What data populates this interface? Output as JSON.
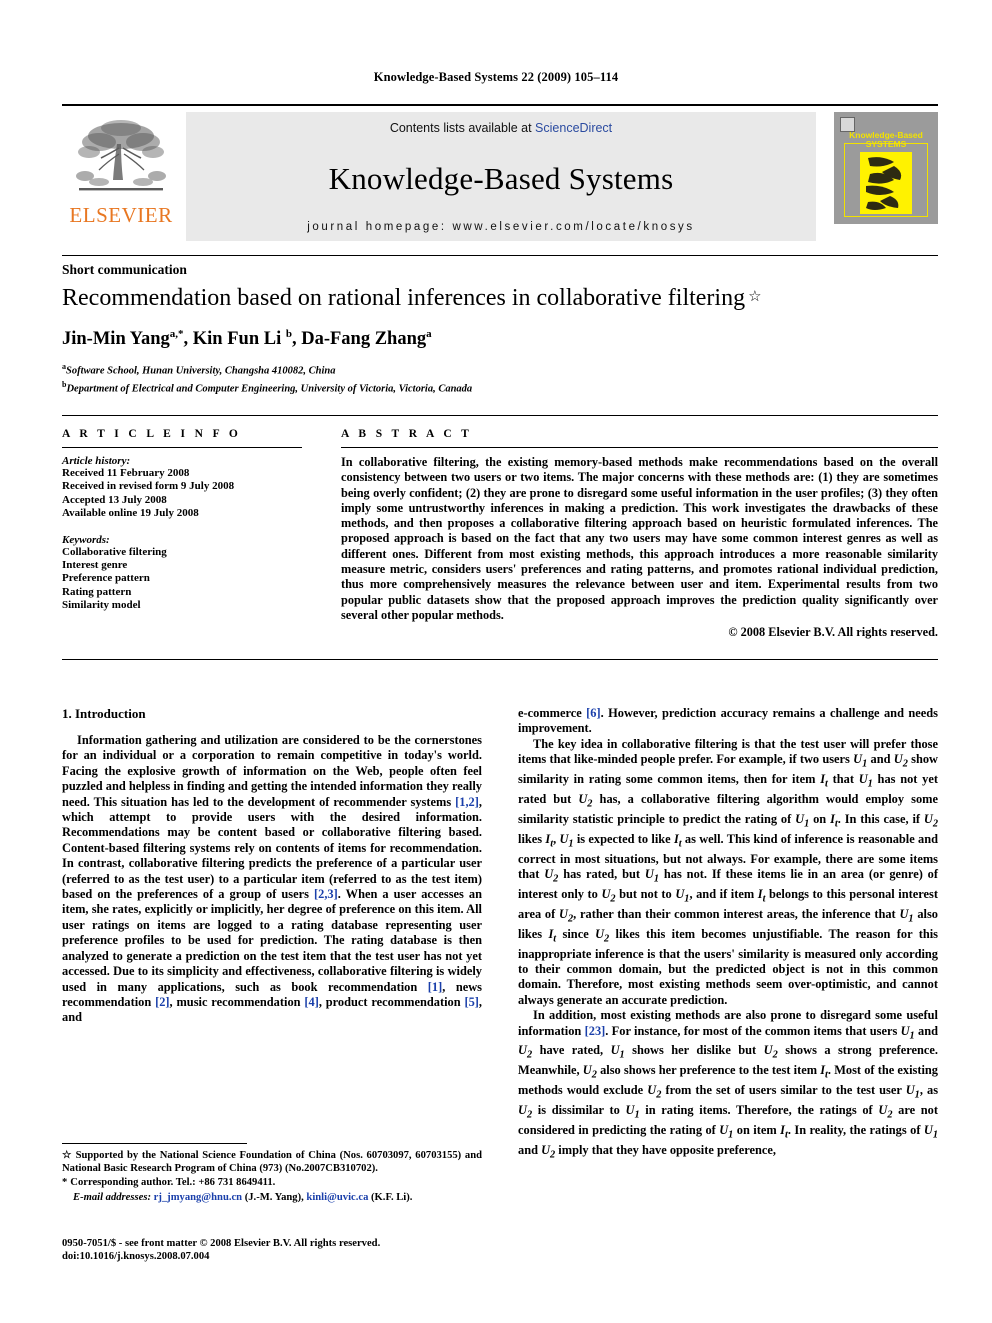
{
  "running_head": "Knowledge-Based Systems 22 (2009) 105–114",
  "masthead": {
    "publisher_word": "ELSEVIER",
    "contents_prefix": "Contents lists available at ",
    "sciencedirect": "ScienceDirect",
    "journal_name": "Knowledge-Based Systems",
    "homepage": "journal homepage: www.elsevier.com/locate/knosys",
    "cover_title_line1": "Knowledge-Based",
    "cover_title_line2": "SYSTEMS"
  },
  "article": {
    "type": "Short communication",
    "title": "Recommendation based on rational inferences in collaborative filtering",
    "title_footnote_mark": "☆",
    "authors": "Jin-Min Yang",
    "author_marks_1": "a,*",
    "author_2": ", Kin Fun Li ",
    "author_marks_2": "b",
    "author_3": ", Da-Fang Zhang",
    "author_marks_3": "a",
    "affiliation_a_mark": "a",
    "affiliation_a": "Software School, Hunan University, Changsha 410082, China",
    "affiliation_b_mark": "b",
    "affiliation_b": "Department of Electrical and Computer Engineering, University of Victoria, Victoria, Canada"
  },
  "info": {
    "heading": "A R T I C L E    I N F O",
    "history_label": "Article history:",
    "history": [
      "Received 11 February 2008",
      "Received in revised form 9 July 2008",
      "Accepted 13 July 2008",
      "Available online 19 July 2008"
    ],
    "keywords_label": "Keywords:",
    "keywords": [
      "Collaborative filtering",
      "Interest genre",
      "Preference pattern",
      "Rating pattern",
      "Similarity model"
    ]
  },
  "abstract": {
    "heading": "A B S T R A C T",
    "text": "In collaborative filtering, the existing memory-based methods make recommendations based on the overall consistency between two users or two items. The major concerns with these methods are: (1) they are sometimes being overly confident; (2) they are prone to disregard some useful information in the user profiles; (3) they often imply some untrustworthy inferences in making a prediction. This work investigates the drawbacks of these methods, and then proposes a collaborative filtering approach based on heuristic formulated inferences. The proposed approach is based on the fact that any two users may have some common interest genres as well as different ones. Different from most existing methods, this approach introduces a more reasonable similarity measure metric, considers users' preferences and rating patterns, and promotes rational individual prediction, thus more comprehensively measures the relevance between user and item. Experimental results from two popular public datasets show that the proposed approach improves the prediction quality significantly over several other popular methods.",
    "copyright": "© 2008 Elsevier B.V. All rights reserved."
  },
  "body": {
    "section_title": "1. Introduction",
    "left_p1_a": "Information gathering and utilization are considered to be the cornerstones for an individual or a corporation to remain competitive in today's world. Facing the explosive growth of information on the Web, people often feel puzzled and helpless in finding and getting the intended information they really need. This situation has led to the development of recommender systems ",
    "left_p1_ref1": "[1,2]",
    "left_p1_b": ", which attempt to provide users with the desired information. Recommendations may be content based or collaborative filtering based. Content-based filtering systems rely on contents of items for recommendation. In contrast, collaborative filtering predicts the preference of a particular user (referred to as the test user) to a particular item (referred to as the test item) based on the preferences of a group of users ",
    "left_p1_ref2": "[2,3]",
    "left_p1_c": ". When a user accesses an item, she rates, explicitly or implicitly, her degree of preference on this item. All user ratings on items are logged to a rating database representing user preference profiles to be used for prediction. The rating database is then analyzed to generate a prediction on the test item that the test user has not yet accessed. Due to its simplicity and effectiveness, collaborative filtering is widely used in many applications, such as book recommendation ",
    "left_p1_ref3": "[1]",
    "left_p1_d": ", news recommendation ",
    "left_p1_ref4": "[2]",
    "left_p1_e": ", music recommendation ",
    "left_p1_ref5": "[4]",
    "left_p1_f": ", product recommendation ",
    "left_p1_ref6": "[5]",
    "left_p1_g": ", and",
    "right_p1_a": "e-commerce ",
    "right_p1_ref": "[6]",
    "right_p1_b": ". However, prediction accuracy remains a challenge and needs improvement.",
    "right_p2": "The key idea in collaborative filtering is that the test user will prefer those items that like-minded people prefer. For example, if two users U1 and U2 show similarity in rating some common items, then for item It that U1 has not yet rated but U2 has, a collaborative filtering algorithm would employ some similarity statistic principle to predict the rating of U1 on It. In this case, if U2 likes It, U1 is expected to like It as well. This kind of inference is reasonable and correct in most situations, but not always. For example, there are some items that U2 has rated, but U1 has not. If these items lie in an area (or genre) of interest only to U2 but not to U1, and if item It belongs to this personal interest area of U2, rather than their common interest areas, the inference that U1 also likes It since U2 likes this item becomes unjustifiable. The reason for this inappropriate inference is that the users' similarity is measured only according to their common domain, but the predicted object is not in this common domain. Therefore, most existing methods seem over-optimistic, and cannot always generate an accurate prediction.",
    "right_p3_a": "In addition, most existing methods are also prone to disregard some useful information ",
    "right_p3_ref": "[23]",
    "right_p3_b": ". For instance, for most of the common items that users U1 and U2 have rated, U1 shows her dislike but U2 shows a strong preference. Meanwhile, U2 also shows her preference to the test item It. Most of the existing methods would exclude U2 from the set of users similar to the test user U1, as U2 is dissimilar to U1 in rating items. Therefore, the ratings of U2 are not considered in predicting the rating of U1 on item It. In reality, the ratings of U1 and U2 imply that they have opposite preference,"
  },
  "footnotes": {
    "funding_mark": "☆",
    "funding": "Supported by the National Science Foundation of China (Nos. 60703097, 60703155) and National Basic Research Program of China (973) (No.2007CB310702).",
    "corresponding_mark": "*",
    "corresponding": "Corresponding author. Tel.: +86 731 8649411.",
    "email_label": "E-mail addresses:",
    "email_1": "rj_jmyang@hnu.cn",
    "email_1_who": " (J.-M. Yang), ",
    "email_2": "kinli@uvic.ca",
    "email_2_who": " (K.F. Li)."
  },
  "imprint": {
    "issn_line": "0950-7051/$ - see front matter © 2008 Elsevier B.V. All rights reserved.",
    "doi_line": "doi:10.1016/j.knosys.2008.07.004"
  },
  "colors": {
    "elsevier_orange": "#E87722",
    "link_blue": "#1a3faa",
    "sciencedirect_blue": "#2b4ba0",
    "masthead_gray": "#e9e9e9",
    "cover_gray": "#9b9b9b",
    "cover_yellow": "#f2e200"
  }
}
